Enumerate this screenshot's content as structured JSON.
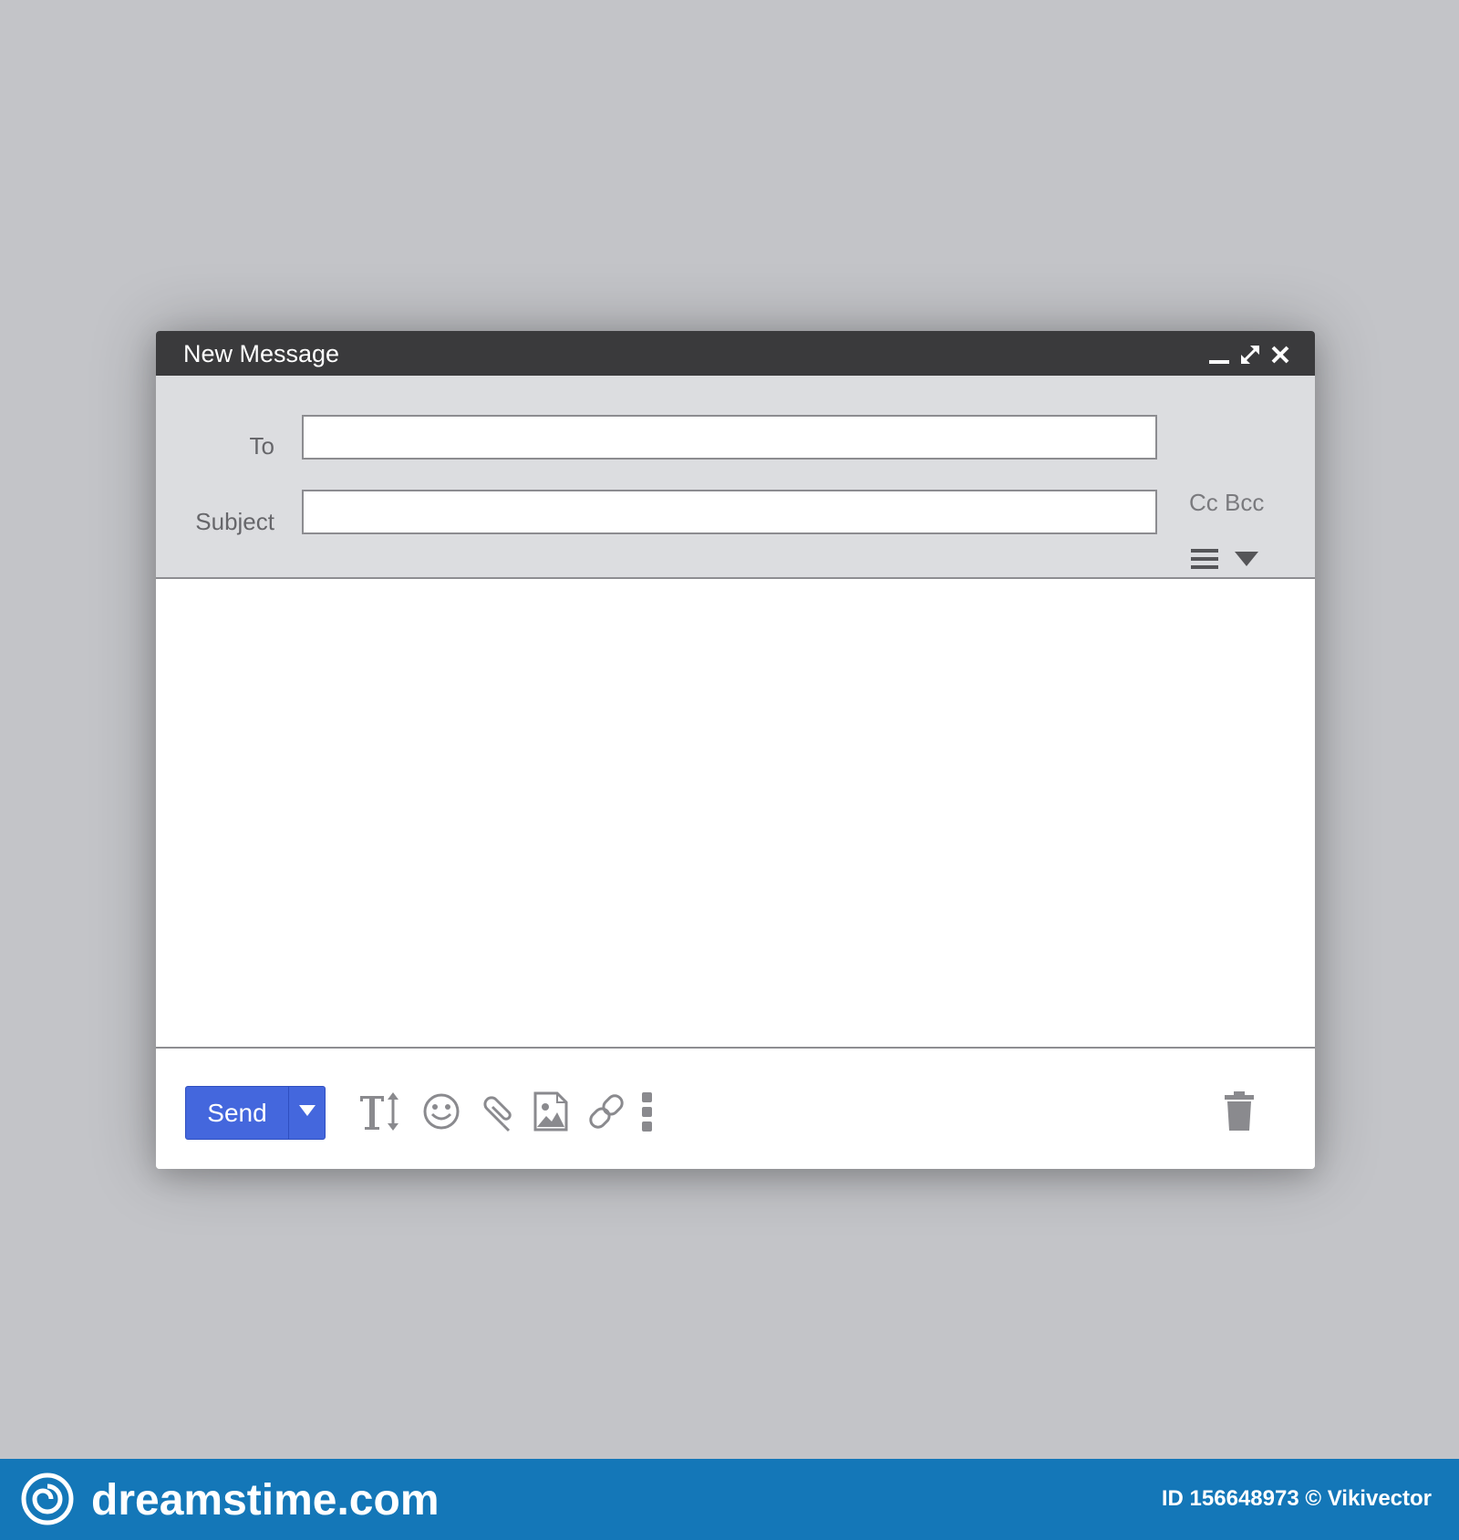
{
  "window": {
    "title": "New Message",
    "controls": {
      "minimize": "minimize-icon",
      "expand": "expand-icon",
      "close": "close-icon"
    }
  },
  "fields": {
    "to": {
      "label": "To",
      "value": ""
    },
    "subject": {
      "label": "Subject",
      "value": ""
    },
    "cc_label": "Cc",
    "bcc_label": "Bcc"
  },
  "body": {
    "value": ""
  },
  "footer": {
    "send_label": "Send",
    "tools": [
      "text-format-icon",
      "emoji-icon",
      "attachment-icon",
      "image-icon",
      "link-icon",
      "more-vertical-icon"
    ],
    "delete": "trash-icon"
  },
  "watermark": {
    "brand": "dreamstime.com",
    "credit": "ID 156648973 © Vikivector"
  },
  "colors": {
    "background": "#c3c4c8",
    "titlebar": "#3a3a3c",
    "header": "#dcdde0",
    "send_button": "#4467dd",
    "icon_gray": "#8a8a8e",
    "watermark_bar": "#1477b8"
  }
}
